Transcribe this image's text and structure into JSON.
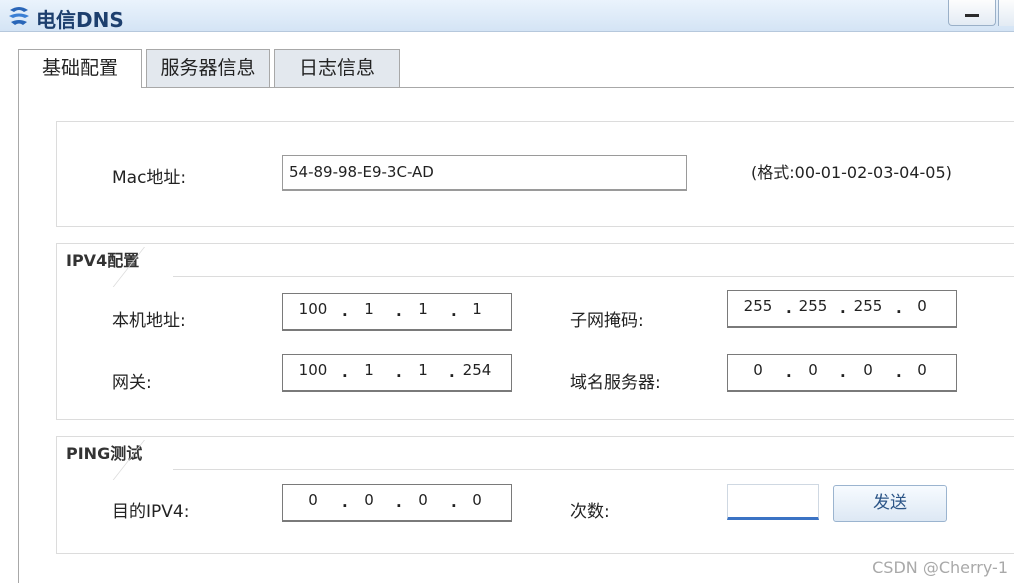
{
  "window": {
    "title": "电信DNS",
    "icon": "app-logo-icon",
    "minimize_icon": "minimize-icon"
  },
  "tabs": [
    {
      "label": "基础配置",
      "active": true
    },
    {
      "label": "服务器信息",
      "active": false
    },
    {
      "label": "日志信息",
      "active": false
    }
  ],
  "mac": {
    "label": "Mac地址:",
    "value": "54-89-98-E9-3C-AD",
    "hint": "(格式:00-01-02-03-04-05)"
  },
  "ipv4": {
    "group_title": "IPV4配置",
    "host_label": "本机地址:",
    "host": [
      "100",
      "1",
      "1",
      "1"
    ],
    "mask_label": "子网掩码:",
    "mask": [
      "255",
      "255",
      "255",
      "0"
    ],
    "gateway_label": "网关:",
    "gateway": [
      "100",
      "1",
      "1",
      "254"
    ],
    "dns_label": "域名服务器:",
    "dns": [
      "0",
      "0",
      "0",
      "0"
    ]
  },
  "ping": {
    "group_title": "PING测试",
    "target_label": "目的IPV4:",
    "target": [
      "0",
      "0",
      "0",
      "0"
    ],
    "count_label": "次数:",
    "count_value": "",
    "send_label": "发送"
  },
  "watermark": "CSDN @Cherry-1",
  "colors": {
    "title_text": "#1d3f6e",
    "titlebar_top": "#eaf3fc",
    "inactive_tab": "#e3e8ee",
    "count_focus": "#3b73c4",
    "button_text": "#2c5587"
  }
}
